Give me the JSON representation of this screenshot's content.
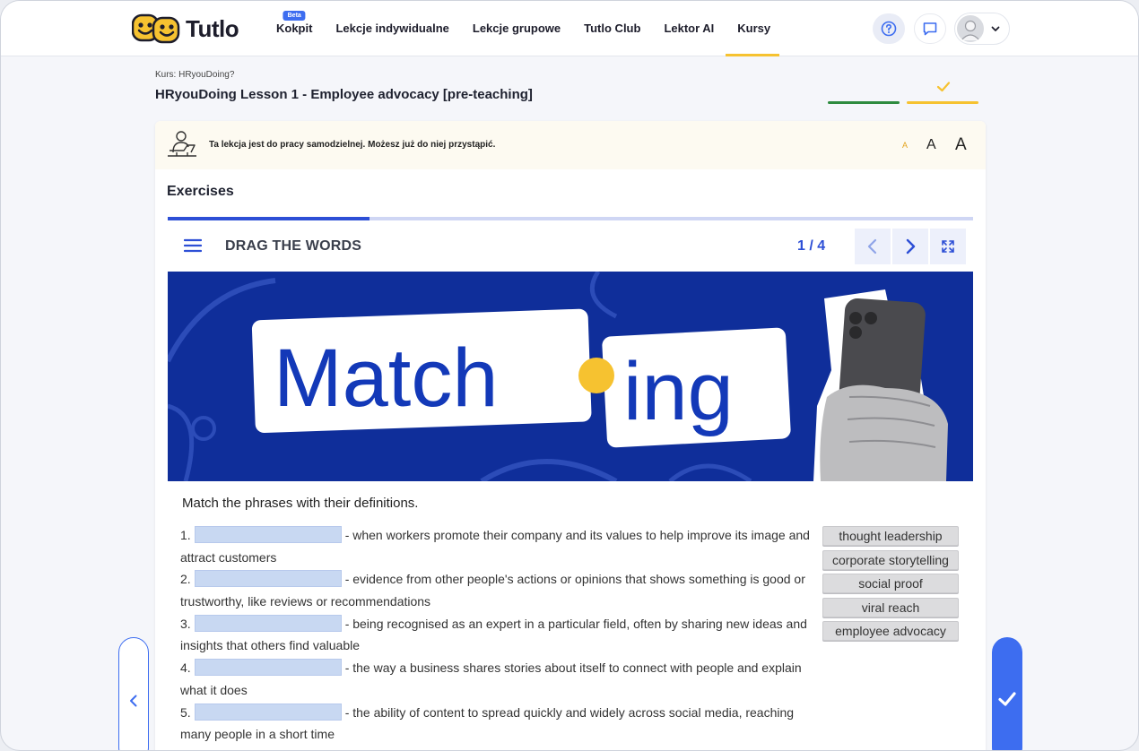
{
  "app": {
    "name": "Tutlo"
  },
  "nav": {
    "items": [
      {
        "label": "Kokpit",
        "badge": "Beta"
      },
      {
        "label": "Lekcje indywidualne"
      },
      {
        "label": "Lekcje grupowe"
      },
      {
        "label": "Tutlo Club"
      },
      {
        "label": "Lektor AI"
      },
      {
        "label": "Kursy",
        "active": true
      }
    ]
  },
  "header_icons": [
    "help-icon",
    "chat-icon",
    "user-avatar-icon",
    "chevron-down-icon"
  ],
  "course": {
    "label": "Kurs: HRyouDoing?",
    "lesson_title": "HRyouDoing Lesson 1 - Employee advocacy [pre-teaching]"
  },
  "notice": {
    "text": "Ta lekcja jest do pracy samodzielnej. Możesz już do niej przystąpić.",
    "font_sizes": [
      "A",
      "A",
      "A"
    ]
  },
  "exercises": {
    "heading": "Exercises",
    "progress_fraction": 0.25,
    "h5p_title": "DRAG THE WORDS",
    "counter": "1 / 4",
    "banner": {
      "word_left": "Match",
      "word_right": "ing",
      "bg_color": "#0f2e9a",
      "dot_color": "#f6c230"
    },
    "instruction": "Match the phrases with their definitions.",
    "items": [
      {
        "num": "1.",
        "definition": "- when workers promote their company and its values to help improve its image and attract customers"
      },
      {
        "num": "2.",
        "definition": "- evidence from other people's actions or opinions that shows something is good or trustworthy, like reviews or recommendations"
      },
      {
        "num": "3.",
        "definition": "- being recognised as an expert in a particular field, often by sharing new ideas and insights that others find valuable"
      },
      {
        "num": "4.",
        "definition": "- the way a business shares stories about itself to connect with people and explain what it does"
      },
      {
        "num": "5.",
        "definition": "- the ability of content to spread quickly and widely across social media, reaching many people in a short time"
      }
    ],
    "word_bank": [
      "thought leadership",
      "corporate storytelling",
      "social proof",
      "viral reach",
      "employee advocacy"
    ]
  },
  "colors": {
    "accent": "#3d6df0",
    "brand_yellow": "#f6c230",
    "progress_green": "#2e8b3f",
    "h5p_blue": "#2d4fd6"
  }
}
